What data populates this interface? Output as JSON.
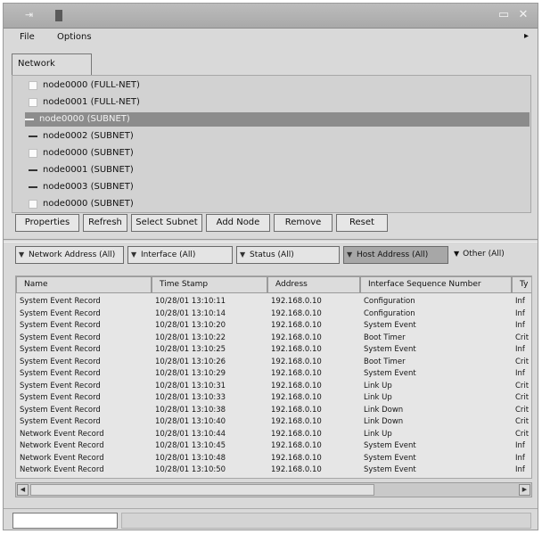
{
  "window": {
    "title": ""
  },
  "menu": {
    "items": [
      "File",
      "Options"
    ],
    "overflow_arrow": "▸"
  },
  "tabs": [
    {
      "label": "Network"
    }
  ],
  "nodes": [
    {
      "label": "node0000 (FULL-NET)",
      "check": "empty",
      "selected": false
    },
    {
      "label": "node0001 (FULL-NET)",
      "check": "empty",
      "selected": false
    },
    {
      "label": "node0000 (SUBNET)",
      "check": "dash",
      "selected": true
    },
    {
      "label": "node0002 (SUBNET)",
      "check": "dash",
      "selected": false
    },
    {
      "label": "node0000 (SUBNET)",
      "check": "empty",
      "selected": false
    },
    {
      "label": "node0001 (SUBNET)",
      "check": "dash",
      "selected": false
    },
    {
      "label": "node0003 (SUBNET)",
      "check": "dash",
      "selected": false
    },
    {
      "label": "node0000 (SUBNET)",
      "check": "empty",
      "selected": false
    }
  ],
  "buttons": [
    "Properties",
    "Refresh",
    "Select Subnet",
    "Add Node",
    "Remove",
    "Reset"
  ],
  "filters": [
    {
      "label": "Network Address (All)",
      "dark": false
    },
    {
      "label": "Interface (All)",
      "dark": false
    },
    {
      "label": "Status (All)",
      "dark": false
    },
    {
      "label": "Host Address (All)",
      "dark": true
    }
  ],
  "filters_more": "Other (All)",
  "table": {
    "headers": [
      "Name",
      "Time Stamp",
      "Address",
      "Interface Sequence Number",
      "Ty"
    ],
    "rows": [
      [
        "System Event Record",
        "10/28/01 13:10:11",
        "192.168.0.10",
        "Configuration",
        "Inf"
      ],
      [
        "System Event Record",
        "10/28/01 13:10:14",
        "192.168.0.10",
        "Configuration",
        "Inf"
      ],
      [
        "System Event Record",
        "10/28/01 13:10:20",
        "192.168.0.10",
        "System Event",
        "Inf"
      ],
      [
        "System Event Record",
        "10/28/01 13:10:22",
        "192.168.0.10",
        "Boot Timer",
        "Crit"
      ],
      [
        "System Event Record",
        "10/28/01 13:10:25",
        "192.168.0.10",
        "System Event",
        "Inf"
      ],
      [
        "System Event Record",
        "10/28/01 13:10:26",
        "192.168.0.10",
        "Boot Timer",
        "Crit"
      ],
      [
        "System Event Record",
        "10/28/01 13:10:29",
        "192.168.0.10",
        "System Event",
        "Inf"
      ],
      [
        "System Event Record",
        "10/28/01 13:10:31",
        "192.168.0.10",
        "Link Up",
        "Crit"
      ],
      [
        "System Event Record",
        "10/28/01 13:10:33",
        "192.168.0.10",
        "Link Up",
        "Crit"
      ],
      [
        "System Event Record",
        "10/28/01 13:10:38",
        "192.168.0.10",
        "Link Down",
        "Crit"
      ],
      [
        "System Event Record",
        "10/28/01 13:10:40",
        "192.168.0.10",
        "Link Down",
        "Crit"
      ],
      [
        "Network Event Record",
        "10/28/01 13:10:44",
        "192.168.0.10",
        "Link Up",
        "Crit"
      ],
      [
        "Network Event Record",
        "10/28/01 13:10:45",
        "192.168.0.10",
        "System Event",
        "Inf"
      ],
      [
        "Network Event Record",
        "10/28/01 13:10:48",
        "192.168.0.10",
        "System Event",
        "Inf"
      ],
      [
        "Network Event Record",
        "10/28/01 13:10:50",
        "192.168.0.10",
        "System Event",
        "Inf"
      ]
    ]
  },
  "colors": {
    "selection": "#8c8c8c",
    "title_highlight": "#5a5a5a"
  }
}
